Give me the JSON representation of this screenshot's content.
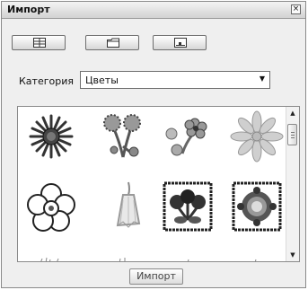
{
  "window": {
    "title": "Импорт",
    "close_glyph": "×"
  },
  "toolbar": {
    "buttons": [
      {
        "icon": "grid-view-icon"
      },
      {
        "icon": "folder-icon"
      },
      {
        "icon": "image-icon"
      }
    ]
  },
  "category": {
    "label": "Категория",
    "selected": "Цветы"
  },
  "gallery": {
    "items": [
      {
        "icon": "daisy-flower-icon"
      },
      {
        "icon": "wildflower-branch-icon"
      },
      {
        "icon": "flower-sprig-icon"
      },
      {
        "icon": "pink-aster-icon"
      },
      {
        "icon": "outline-flower-icon"
      },
      {
        "icon": "bellflower-icon"
      },
      {
        "icon": "framed-bouquet-icon"
      },
      {
        "icon": "framed-wreath-icon"
      }
    ]
  },
  "footer": {
    "import_label": "Импорт"
  },
  "colors": {
    "dark": "#222222",
    "gray": "#888888",
    "green": "#3e8a4e",
    "red": "#b13b3b",
    "pink": "#e27fa1",
    "teal": "#2f8f7a"
  }
}
